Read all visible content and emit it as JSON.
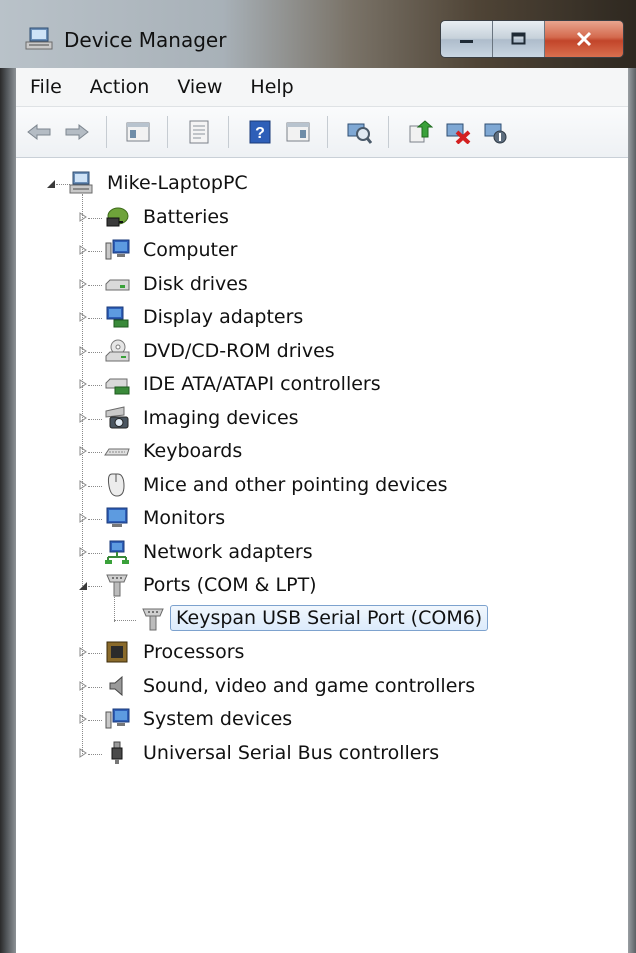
{
  "window": {
    "title": "Device Manager",
    "buttons": {
      "minimize": "minimize",
      "maximize": "maximize",
      "close": "close"
    }
  },
  "menu": [
    "File",
    "Action",
    "View",
    "Help"
  ],
  "toolbar": {
    "icons": [
      "back-icon",
      "forward-icon",
      "show-hide-console-tree-icon",
      "properties-icon",
      "help-icon",
      "action-pane-icon",
      "scan-hardware-icon",
      "update-driver-icon",
      "uninstall-icon",
      "disable-icon"
    ]
  },
  "tree": {
    "root": "Mike-LaptopPC",
    "categories": [
      {
        "label": "Batteries",
        "icon": "battery-icon",
        "expanded": false
      },
      {
        "label": "Computer",
        "icon": "computer-icon",
        "expanded": false
      },
      {
        "label": "Disk drives",
        "icon": "disk-drive-icon",
        "expanded": false
      },
      {
        "label": "Display adapters",
        "icon": "display-adapter-icon",
        "expanded": false
      },
      {
        "label": "DVD/CD-ROM drives",
        "icon": "dvd-drive-icon",
        "expanded": false
      },
      {
        "label": "IDE ATA/ATAPI controllers",
        "icon": "ide-controller-icon",
        "expanded": false
      },
      {
        "label": "Imaging devices",
        "icon": "camera-icon",
        "expanded": false
      },
      {
        "label": "Keyboards",
        "icon": "keyboard-icon",
        "expanded": false
      },
      {
        "label": "Mice and other pointing devices",
        "icon": "mouse-icon",
        "expanded": false
      },
      {
        "label": "Monitors",
        "icon": "monitor-icon",
        "expanded": false
      },
      {
        "label": "Network adapters",
        "icon": "network-adapter-icon",
        "expanded": false
      },
      {
        "label": "Ports (COM & LPT)",
        "icon": "port-icon",
        "expanded": true
      },
      {
        "label": "Keyspan USB Serial Port (COM6)",
        "icon": "port-icon",
        "child": true,
        "selected": true
      },
      {
        "label": "Processors",
        "icon": "processor-icon",
        "expanded": false
      },
      {
        "label": "Sound, video and game controllers",
        "icon": "speaker-icon",
        "expanded": false
      },
      {
        "label": "System devices",
        "icon": "system-device-icon",
        "expanded": false
      },
      {
        "label": "Universal Serial Bus controllers",
        "icon": "usb-icon",
        "expanded": false
      }
    ]
  },
  "colors": {
    "selection_border": "#7da2ce",
    "selection_fill": "#dcebfc",
    "close_button": "#c2452a"
  }
}
